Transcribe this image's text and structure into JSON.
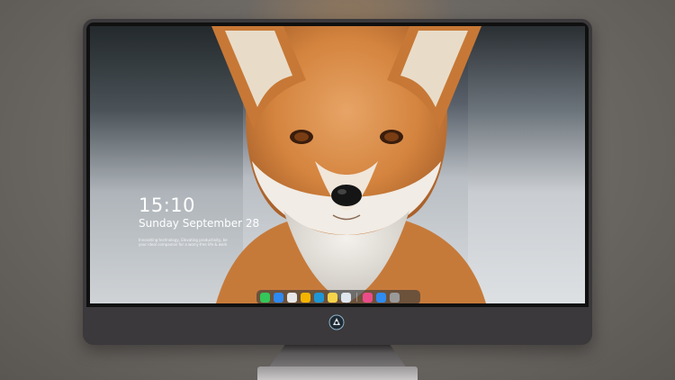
{
  "lock_screen": {
    "time": "15:10",
    "date": "Sunday September 28",
    "blurb_line1": "Innovating technology, Elevating productivity, be",
    "blurb_line2": "your ideal companion for a worry-free life & work"
  },
  "dock": {
    "apps": [
      {
        "icon": "messages-icon",
        "color": "#34c759"
      },
      {
        "icon": "finder-icon",
        "color": "#2e89f0"
      },
      {
        "icon": "chrome-icon",
        "color": "#e8e8e8"
      },
      {
        "icon": "photos-icon",
        "color": "#f4b400"
      },
      {
        "icon": "clapper-icon",
        "color": "#1e96d6"
      },
      {
        "icon": "notes-icon",
        "color": "#f7d44a"
      },
      {
        "icon": "calendar-icon",
        "color": "#dfe6ee"
      },
      {
        "icon": "music-icon",
        "color": "#ea4c89"
      },
      {
        "icon": "app-store-icon",
        "color": "#2f8cf0"
      },
      {
        "icon": "camera-icon",
        "color": "#9a9a9a"
      }
    ]
  },
  "colors": {
    "bezel": "#101010",
    "chassis": "#3b393b",
    "fox_orange": "#d4843e"
  }
}
